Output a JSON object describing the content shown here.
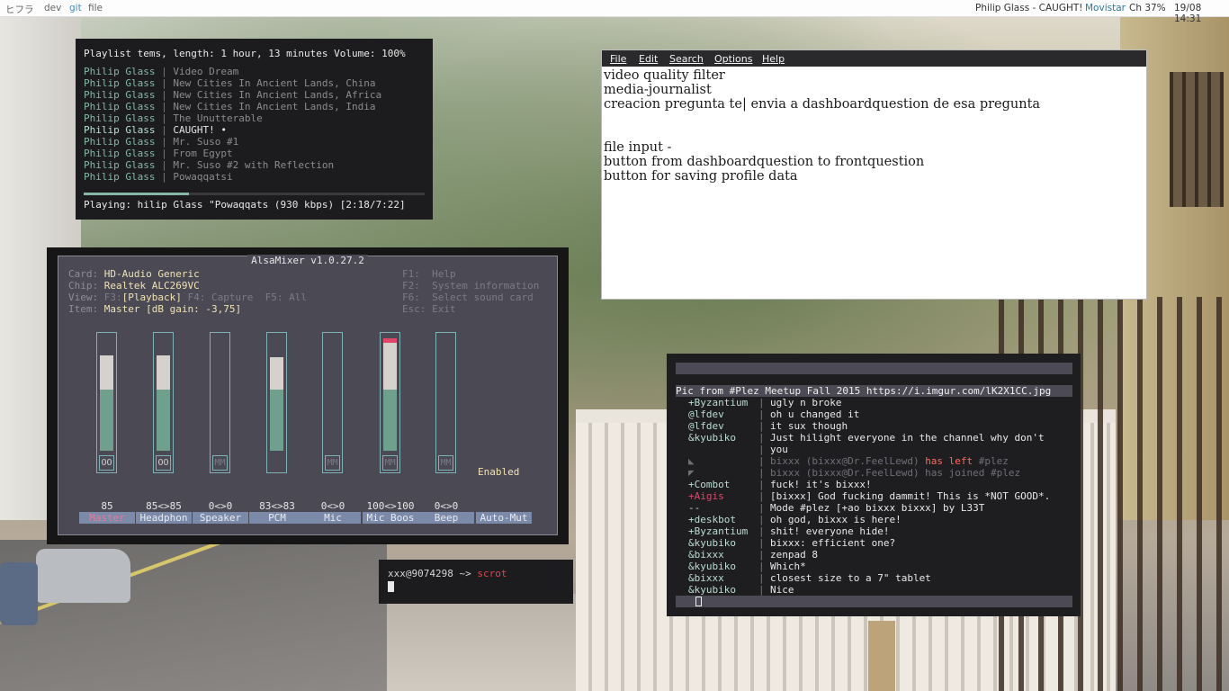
{
  "topbar": {
    "tags": [
      "ヒフラ",
      "dev",
      "git",
      "file"
    ],
    "active_tag": "git",
    "now_playing": "Philip Glass - CAUGHT!",
    "network": "Movistar",
    "battery": "Ch 37%",
    "datetime": "19/08 14:31"
  },
  "playlist": {
    "header": "Playlist tems, length: 1 hour, 13 minutes Volume: 100%",
    "tracks": [
      {
        "artist": "Philip Glass",
        "title": "Video Dream"
      },
      {
        "artist": "Philip Glass",
        "title": "New Cities In Ancient Lands, China"
      },
      {
        "artist": "Philip Glass",
        "title": "New Cities In Ancient Lands, Africa"
      },
      {
        "artist": "Philip Glass",
        "title": "New Cities In Ancient Lands, India"
      },
      {
        "artist": "Philip Glass",
        "title": "The Unutterable"
      },
      {
        "artist": "Philip Glass",
        "title": "CAUGHT! •"
      },
      {
        "artist": "Philip Glass",
        "title": "Mr. Suso #1"
      },
      {
        "artist": "Philip Glass",
        "title": "From Egypt"
      },
      {
        "artist": "Philip Glass",
        "title": "Mr. Suso #2 with Reflection"
      },
      {
        "artist": "Philip Glass",
        "title": "Powaqqatsi"
      }
    ],
    "progress": 0.31,
    "playing": "Playing: hilip Glass \"Powaqqats (930 kbps) [2:18/7:22]"
  },
  "alsamixer": {
    "title": "AlsaMixer v1.0.27.2",
    "card_label": "Card:",
    "card": "HD-Audio Generic",
    "chip_label": "Chip:",
    "chip": "Realtek ALC269VC",
    "view_label": "View:",
    "view_f3": "F3:",
    "view_playback": "[Playback]",
    "view_rest": "F4: Capture  F5: All",
    "item_label": "Item:",
    "item": "Master [dB gain: -3,75]",
    "help": [
      "F1:  Help",
      "F2:  System information",
      "F6:  Select sound card",
      "Esc: Exit"
    ],
    "enabled": "Enabled",
    "channels": [
      {
        "name": "Master",
        "value": "85",
        "level": 0.85,
        "box": "OO",
        "muted": false
      },
      {
        "name": "Headphon",
        "value": "85<>85",
        "level": 0.85,
        "box": "OO",
        "muted": false
      },
      {
        "name": "Speaker",
        "value": "0<>0",
        "level": 0,
        "box": "MM",
        "muted": true
      },
      {
        "name": "PCM",
        "value": "83<>83",
        "level": 0.83,
        "box": "",
        "muted": false
      },
      {
        "name": "Mic",
        "value": "0<>0",
        "level": 0,
        "box": "MM",
        "muted": true
      },
      {
        "name": "Mic Boos",
        "value": "100<>100",
        "level": 1.0,
        "box": "MM",
        "muted": true
      },
      {
        "name": "Beep",
        "value": "0<>0",
        "level": 0,
        "box": "MM",
        "muted": true
      },
      {
        "name": "Auto-Mut",
        "value": "",
        "level": null,
        "box": "",
        "muted": false
      }
    ],
    "colors": {
      "low": "#6fa08e",
      "mid": "#d6d1cc",
      "high": "#e0466a"
    }
  },
  "shell": {
    "prompt": "xxx@9074298 ~> ",
    "command": "scrot"
  },
  "editor": {
    "menu": [
      "File",
      "Edit",
      "Search",
      "Options",
      "Help"
    ],
    "lines": [
      "video quality filter",
      "media-journalist",
      "creacion pregunta te| envia a dashboardquestion de esa pregunta",
      "",
      "",
      "file input -",
      "button from dashboardquestion to frontquestion",
      "button for saving profile data"
    ]
  },
  "irc": {
    "topic": "Pic from #Plez Meetup Fall 2015 https://i.imgur.com/lK2X1CC.jpg",
    "lines": [
      {
        "nick": "+Byzantium",
        "msg": "ugly n broke"
      },
      {
        "nick": "@lfdev",
        "msg": "oh u changed it"
      },
      {
        "nick": "@lfdev",
        "msg": "it sux though"
      },
      {
        "nick": "&kyubiko",
        "msg": "Just hilight everyone in the channel why don't"
      },
      {
        "nick": "",
        "msg": "you"
      },
      {
        "nick": "◣",
        "msg": "bixxx (bixxx@Dr.FeelLewd) ",
        "extra": "has left",
        "tail": " #plez",
        "dim": true
      },
      {
        "nick": "◤",
        "msg": "bixxx (bixxx@Dr.FeelLewd) has joined #plez",
        "dim": true
      },
      {
        "nick": "+Combot",
        "msg": "fuck! it's bixxx!"
      },
      {
        "nick": "+Aigis",
        "msg": "[bixxx] God fucking dammit! This is *NOT GOOD*."
      },
      {
        "nick": "--",
        "msg": "Mode #plez [+ao bixxx bixxx] by L33T"
      },
      {
        "nick": "+deskbot",
        "msg": "oh god, bixxx is here!"
      },
      {
        "nick": "+Byzantium",
        "msg": "shit! everyone hide!"
      },
      {
        "nick": "&kyubiko",
        "msg": "bixxx: efficient one?"
      },
      {
        "nick": "&bixxx",
        "msg": "zenpad 8"
      },
      {
        "nick": "&kyubiko",
        "msg": "Which*"
      },
      {
        "nick": "&bixxx",
        "msg": "closest size to a 7\" tablet"
      },
      {
        "nick": "&kyubiko",
        "msg": "Nice"
      }
    ]
  }
}
